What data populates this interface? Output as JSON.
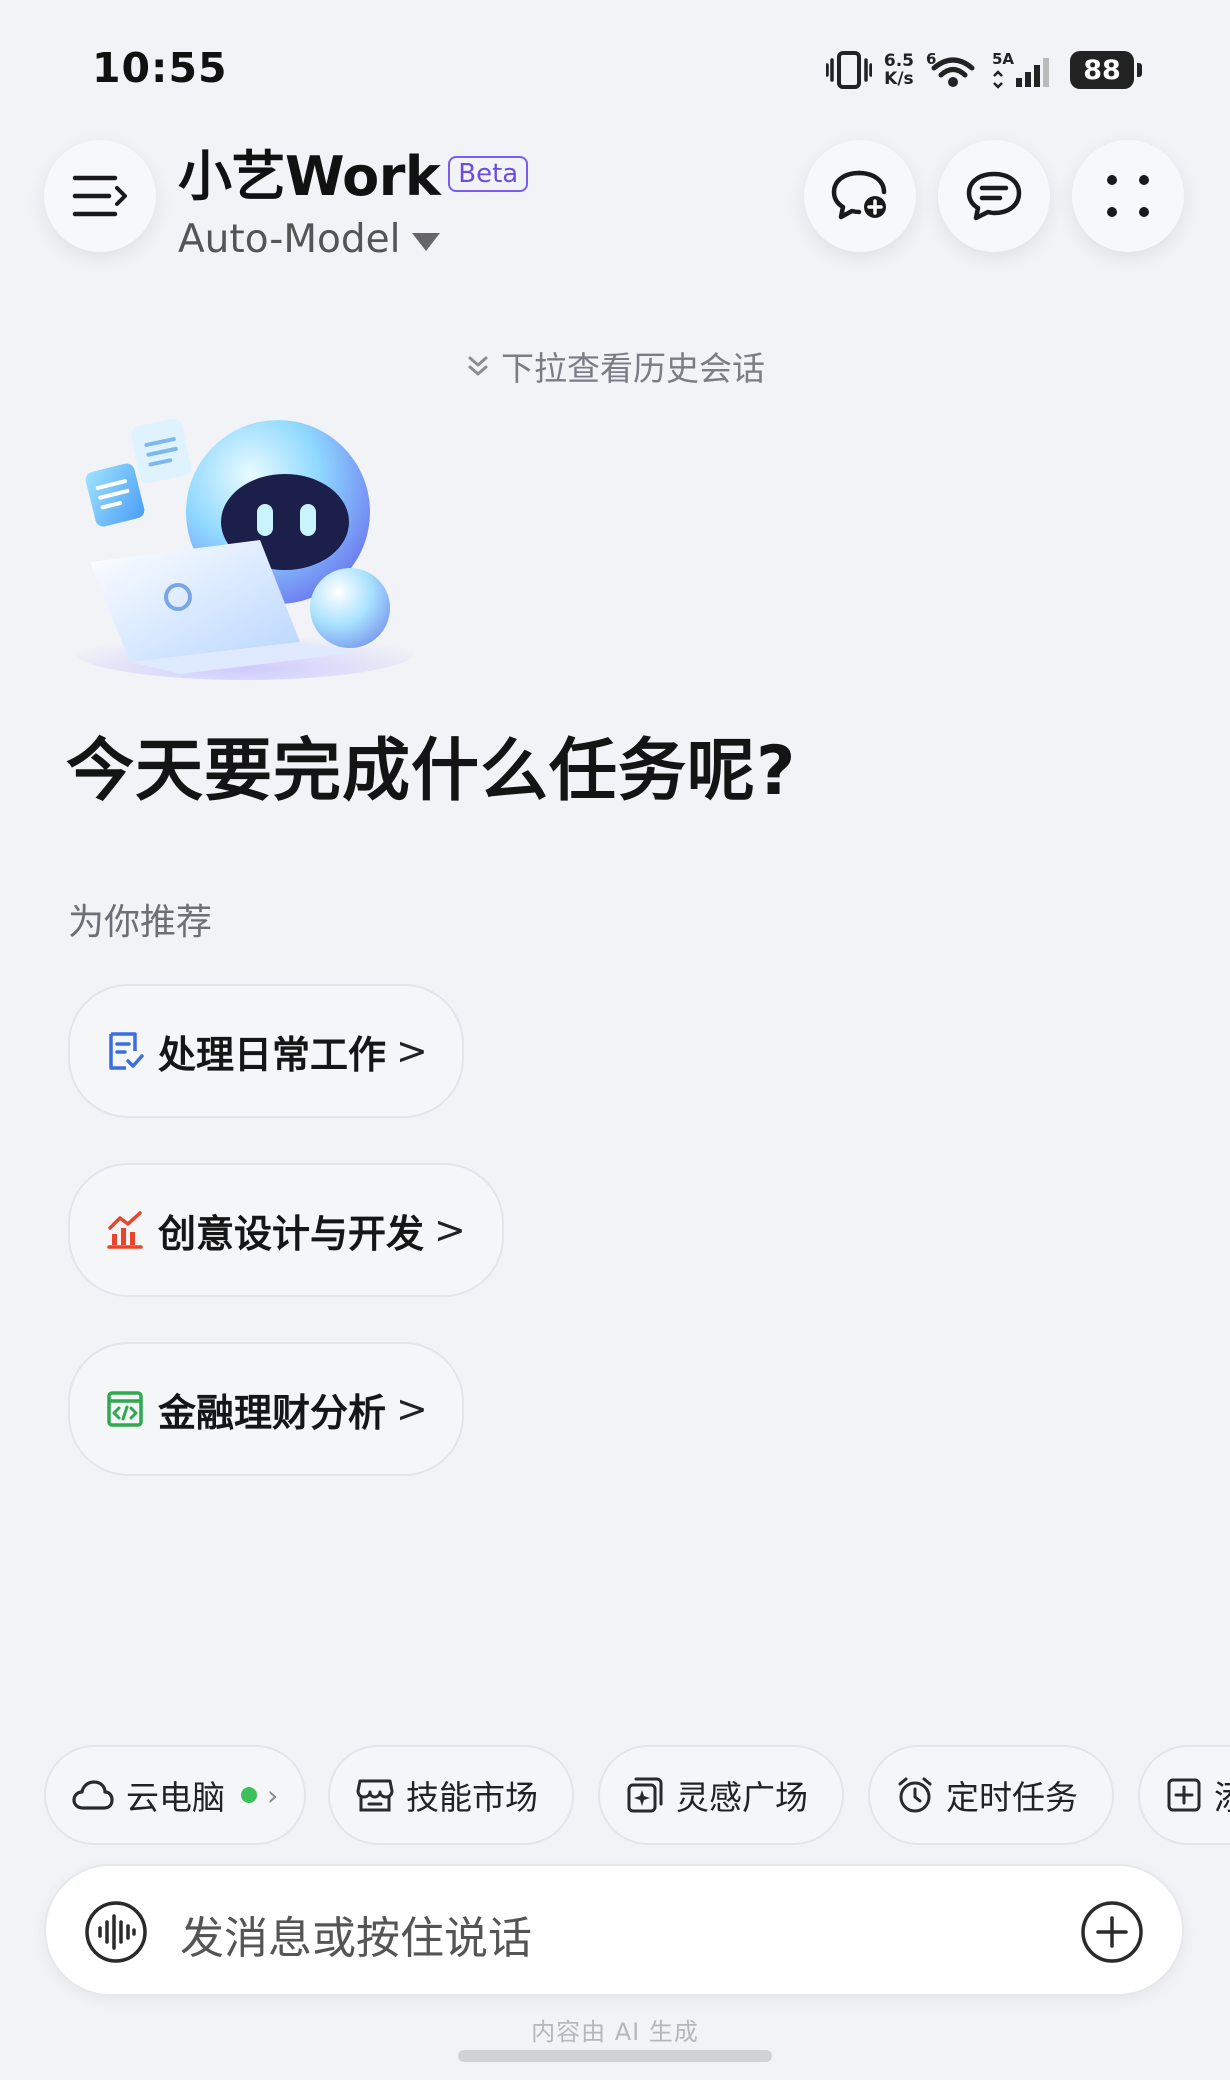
{
  "status_bar": {
    "time": "10:55",
    "net_speed_value": "6.5",
    "net_speed_unit": "K/s",
    "wifi_level": "6",
    "signal_label": "5A",
    "battery": "88"
  },
  "header": {
    "app_title": "小艺Work",
    "beta_label": "Beta",
    "model_name": "Auto-Model",
    "icons": {
      "menu": "menu-icon",
      "new_chat": "new-chat-icon",
      "chats": "chat-list-icon",
      "more": "more-grid-icon"
    }
  },
  "history_hint": "下拉查看历史会话",
  "main": {
    "headline": "今天要完成什么任务呢?",
    "recommend_label": "为你推荐",
    "recommendations": [
      {
        "label": "处理日常工作",
        "icon": "document-check-icon",
        "color": "#3b6fe0"
      },
      {
        "label": "创意设计与开发",
        "icon": "chart-icon",
        "color": "#e8452c"
      },
      {
        "label": "金融理财分析",
        "icon": "code-window-icon",
        "color": "#2fa84f"
      }
    ],
    "chevron": ">"
  },
  "quick_chips": [
    {
      "label": "云电脑",
      "icon": "cloud-icon",
      "status": "online"
    },
    {
      "label": "技能市场",
      "icon": "store-icon"
    },
    {
      "label": "灵感广场",
      "icon": "inspiration-icon"
    },
    {
      "label": "定时任务",
      "icon": "alarm-icon"
    },
    {
      "label": "添",
      "icon": "add-box-icon"
    }
  ],
  "input": {
    "placeholder": "发消息或按住说话",
    "voice_icon": "voice-wave-icon",
    "add_icon": "add-circle-icon"
  },
  "footer_note": "内容由 AI 生成"
}
